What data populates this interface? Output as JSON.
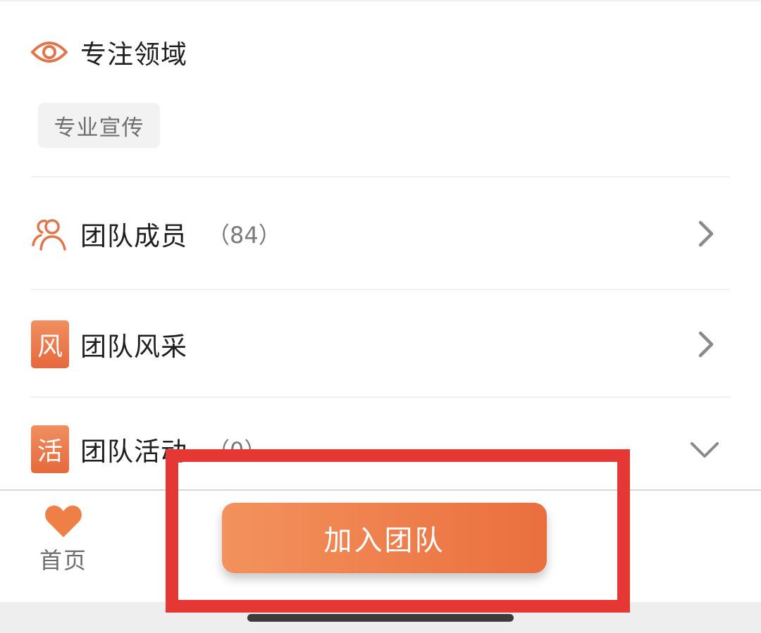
{
  "focus": {
    "title": "专注领域",
    "icon": "eye-icon",
    "tag": "专业宣传"
  },
  "rows": [
    {
      "label": "团队成员",
      "count": "（84）",
      "icon": "people-icon",
      "action": "chevron-right-icon"
    },
    {
      "label": "团队风采",
      "badge": "风",
      "action": "chevron-right-icon"
    },
    {
      "label": "团队活动",
      "count": "（0）",
      "badge": "活",
      "action": "chevron-down-icon"
    }
  ],
  "bottom_bar": {
    "home_label": "首页",
    "home_icon": "heart-icon",
    "join_label": "加入团队"
  },
  "colors": {
    "accent": "#eb7645",
    "highlight": "#e53835"
  }
}
